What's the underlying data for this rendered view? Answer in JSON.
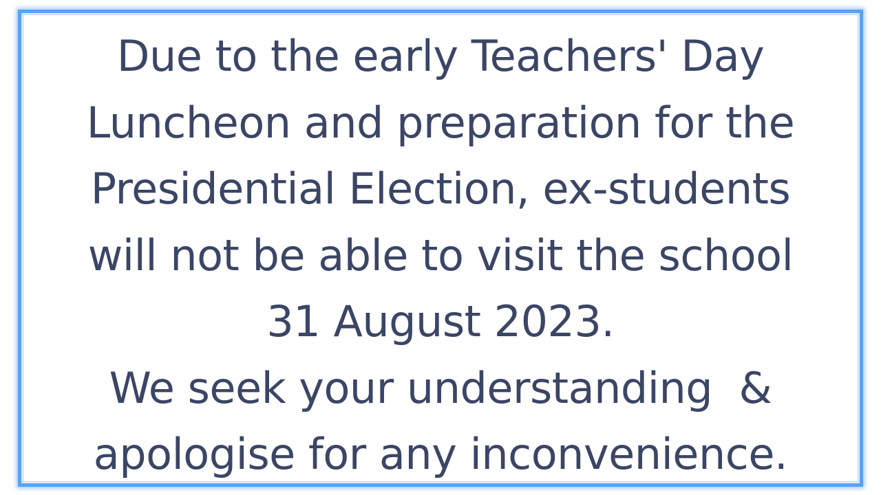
{
  "notice": {
    "lines": [
      "Due to the early Teachers' Day",
      "Luncheon and preparation for the",
      "Presidential Election, ex-students",
      "will not be able to visit the school",
      "31 August 2023.",
      "We seek your understanding  &",
      "apologise for any inconvenience."
    ]
  },
  "colors": {
    "text": "#3b4565",
    "frame_border": "#5aa2f0",
    "background": "#ffffff"
  }
}
